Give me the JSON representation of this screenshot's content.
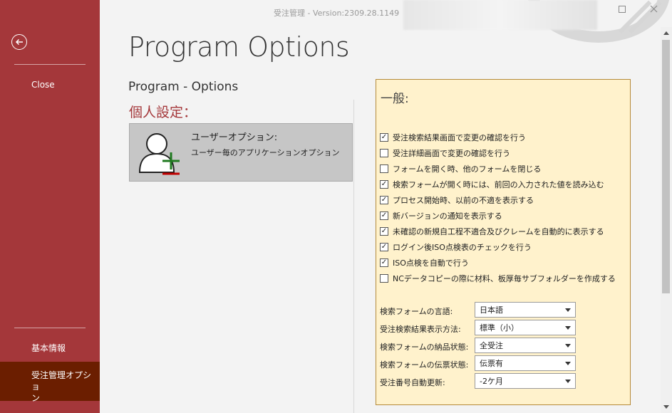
{
  "window": {
    "title": "受注管理 - Version:2309.28.1149"
  },
  "sidebar": {
    "close_label": "Close",
    "items": [
      {
        "label": "基本情報"
      },
      {
        "label": "受注管理オプショ\nン"
      }
    ]
  },
  "page": {
    "title": "Program Options",
    "subtitle": "Program - Options",
    "section_title": "個人設定："
  },
  "user_option": {
    "title": "ユーザーオプション:",
    "description": "ユーザー毎のアプリケーションオプション",
    "icon": "user-add-icon"
  },
  "general": {
    "title": "一般:",
    "checkboxes": [
      {
        "label": "受注検索結果画面で変更の確認を行う",
        "checked": true
      },
      {
        "label": "受注詳細画面で変更の確認を行う",
        "checked": false
      },
      {
        "label": "フォームを開く時、他のフォームを閉じる",
        "checked": false
      },
      {
        "label": "検索フォームが開く時には、前回の入力された値を読み込む",
        "checked": true
      },
      {
        "label": "プロセス開始時、以前の不適を表示する",
        "checked": true
      },
      {
        "label": "新バージョンの通知を表示する",
        "checked": true
      },
      {
        "label": "未確認の新規自工程不適合及びクレームを自動的に表示する",
        "checked": true
      },
      {
        "label": "ログイン後ISO点検表のチェックを行う",
        "checked": true
      },
      {
        "label": "ISO点検を自動で行う",
        "checked": true
      },
      {
        "label": "NCデータコピーの際に材料、板厚毎サブフォルダーを作成する",
        "checked": false
      }
    ],
    "fields": [
      {
        "label": "検索フォームの言語:",
        "value": "日本語"
      },
      {
        "label": "受注検索結果表示方法:",
        "value": "標準（小）"
      },
      {
        "label": "検索フォームの納品状態:",
        "value": "全受注"
      },
      {
        "label": "検索フォームの伝票状態:",
        "value": "伝票有"
      },
      {
        "label": "受注番号自動更新:",
        "value": "-2ケ月"
      }
    ]
  },
  "colors": {
    "sidebar": "#a4373a",
    "sidebar_active": "#6b1e00",
    "panel_bg": "#fff2cc",
    "panel_border": "#b58a3a",
    "accent_text": "#a4373a"
  }
}
